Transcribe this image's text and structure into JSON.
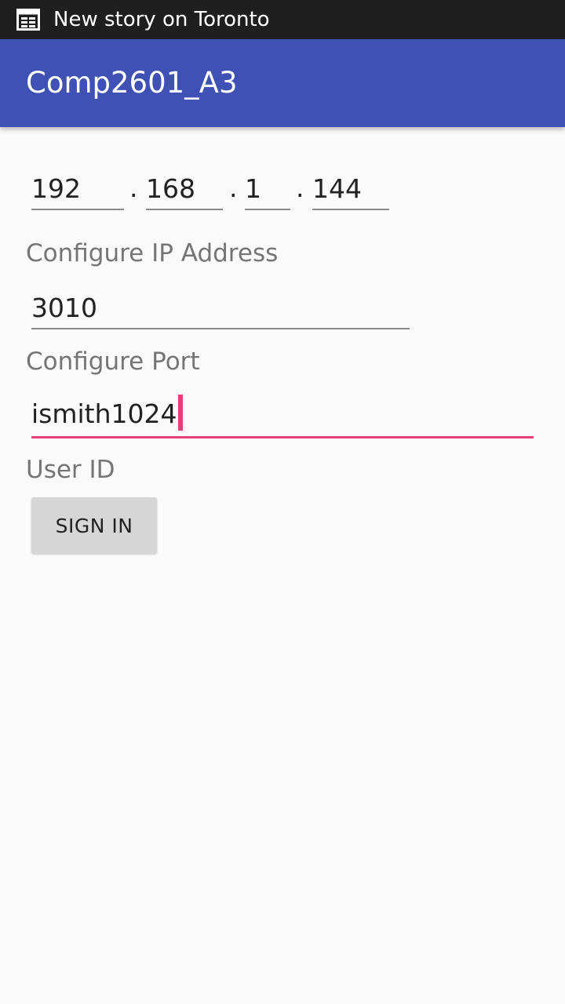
{
  "status_bar": {
    "notification_icon": "newspaper-icon",
    "notification_text": "New story on Toronto"
  },
  "app_bar": {
    "title": "Comp2601_A3",
    "color": "#3f51b5"
  },
  "ip_address": {
    "octets": [
      "192",
      "168",
      "1",
      "144"
    ],
    "separator": ".",
    "label": "Configure IP Address"
  },
  "port": {
    "value": "3010",
    "label": "Configure Port"
  },
  "user_id": {
    "value": "ismith1024",
    "label": "User ID",
    "accent": "#e6407a"
  },
  "sign_in_button": {
    "label": "SIGN IN"
  }
}
